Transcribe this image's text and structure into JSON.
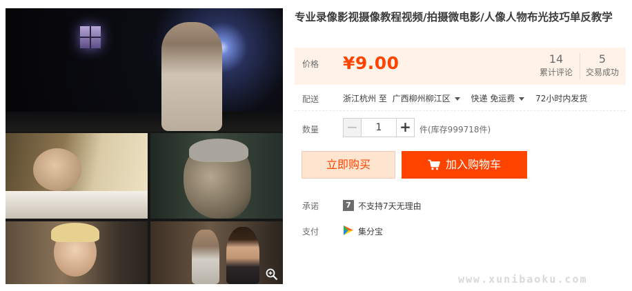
{
  "product": {
    "title": "专业录像影视摄像教程视频/拍摄微电影/人像人物布光技巧单反教学"
  },
  "price": {
    "label": "价格",
    "value": "¥9.00"
  },
  "stats": {
    "reviews_count": "14",
    "reviews_label": "累计评论",
    "sales_count": "5",
    "sales_label": "交易成功"
  },
  "delivery": {
    "label": "配送",
    "origin": "浙江杭州 至",
    "destination": "广西柳州柳江区",
    "shipping": "快递 免运费",
    "ship_time": "72小时内发货"
  },
  "quantity": {
    "label": "数量",
    "value": "1",
    "minus_symbol": "−",
    "plus_symbol": "+",
    "stock": "件(库存999718件)"
  },
  "buttons": {
    "buy_now": "立即购买",
    "add_to_cart": "加入购物车"
  },
  "promise": {
    "label": "承诺",
    "icon_text": "7",
    "text": "不支持7天无理由"
  },
  "payment": {
    "label": "支付",
    "method": "集分宝"
  },
  "watermark": "www.xunibaoku.com",
  "colors": {
    "accent": "#ff4400",
    "price_bg": "#fff2e8",
    "buy_now_bg": "#ffe4d0"
  },
  "icons": {
    "zoom": "magnifier-icon",
    "cart": "cart-icon",
    "payment": "jifenbao-icon"
  }
}
